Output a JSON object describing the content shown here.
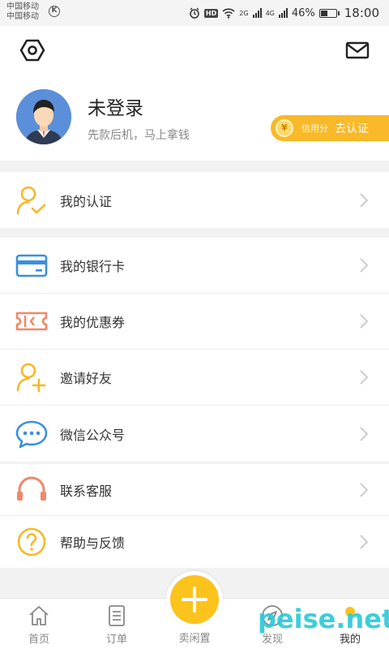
{
  "status_bar": {
    "carrier_line1": "中国移动",
    "carrier_line2": "中国移动",
    "carrier_badge": "K",
    "net1": "2G",
    "net2": "4G",
    "hd": "HD",
    "battery_percent": "46%",
    "battery_level": 0.46,
    "time": "18:00"
  },
  "header": {
    "settings_icon": "settings-hexagon-icon",
    "mail_icon": "mail-icon",
    "username": "未登录",
    "subtitle": "先款后机，马上拿钱",
    "credit_coin": "¥",
    "credit_label": "信用分",
    "credit_action": "去认证"
  },
  "menu_groups": [
    [
      {
        "label": "我的认证",
        "icon": "user-check-icon",
        "color": "#f6b929"
      }
    ],
    [
      {
        "label": "我的银行卡",
        "icon": "bank-card-icon",
        "color": "#3b8fe0"
      },
      {
        "label": "我的优惠券",
        "icon": "coupon-icon",
        "color": "#f08868"
      },
      {
        "label": "邀请好友",
        "icon": "user-add-icon",
        "color": "#f6b929"
      },
      {
        "label": "微信公众号",
        "icon": "wechat-chat-icon",
        "color": "#3b8fe0"
      }
    ],
    [
      {
        "label": "联系客服",
        "icon": "headset-icon",
        "color": "#f08868"
      },
      {
        "label": "帮助与反馈",
        "icon": "help-icon",
        "color": "#f6b929"
      }
    ]
  ],
  "bottom_nav": {
    "items": [
      {
        "label": "首页",
        "icon": "home-icon"
      },
      {
        "label": "订单",
        "icon": "order-list-icon"
      },
      {
        "label": "卖闲置",
        "icon": "plus-icon"
      },
      {
        "label": "发现",
        "icon": "compass-icon"
      },
      {
        "label": "我的",
        "icon": "profile-dot-icon"
      }
    ],
    "active": "我的"
  },
  "colors": {
    "accent": "#fcc31d",
    "blue": "#3b8fe0",
    "orange": "#f08868",
    "background": "#f2f2f2"
  },
  "watermark": "peise.net"
}
